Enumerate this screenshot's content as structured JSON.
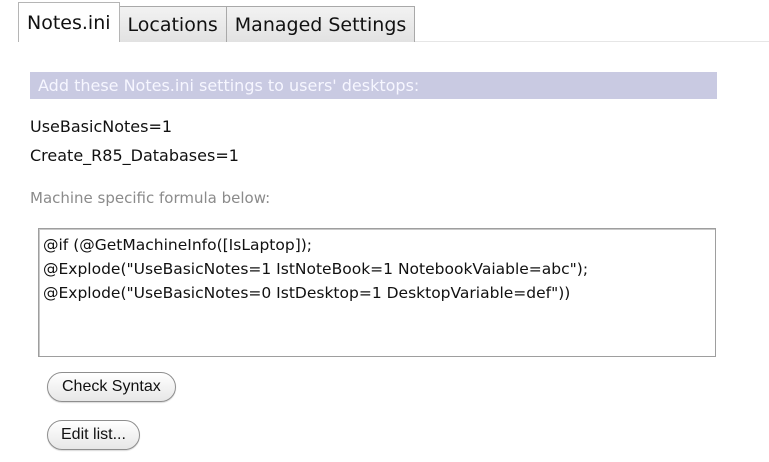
{
  "tabs": [
    {
      "label": "Notes.ini",
      "active": true
    },
    {
      "label": "Locations",
      "active": false
    },
    {
      "label": "Managed Settings",
      "active": false
    }
  ],
  "section": {
    "header": "Add these Notes.ini settings to users' desktops:",
    "settings": [
      "UseBasicNotes=1",
      "Create_R85_Databases=1"
    ],
    "formula_label": "Machine specific formula below:",
    "formula_lines": [
      "@if (@GetMachineInfo([IsLaptop]);",
      "@Explode(\"UseBasicNotes=1 IstNoteBook=1 NotebookVaiable=abc\");",
      "@Explode(\"UseBasicNotes=0 IstDesktop=1 DesktopVariable=def\"))"
    ]
  },
  "buttons": {
    "check_syntax": "Check Syntax",
    "edit_list": "Edit list..."
  },
  "colors": {
    "header_bg": "#c9cae2",
    "header_text": "#f6f6ff",
    "label_gray": "#8b8b8b"
  }
}
